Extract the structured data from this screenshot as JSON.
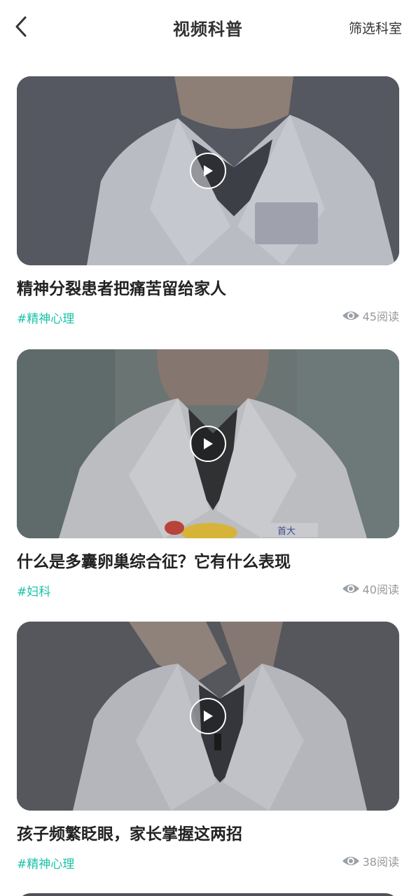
{
  "header": {
    "title": "视频科普",
    "filter_label": "筛选科室"
  },
  "videos": [
    {
      "title": "精神分裂患者把痛苦留给家人",
      "tag": "#精神心理",
      "views": "45阅读"
    },
    {
      "title": "什么是多囊卵巢综合征？它有什么表现",
      "tag": "#妇科",
      "views": "40阅读",
      "thumb_text": "首大"
    },
    {
      "title": "孩子频繁眨眼，家长掌握这两招",
      "tag": "#精神心理",
      "views": "38阅读"
    }
  ],
  "colors": {
    "accent": "#19c3a8",
    "text": "#222222",
    "muted": "#999999"
  },
  "icons": {
    "back": "chevron-left-icon",
    "play": "play-icon",
    "views": "eye-icon"
  }
}
